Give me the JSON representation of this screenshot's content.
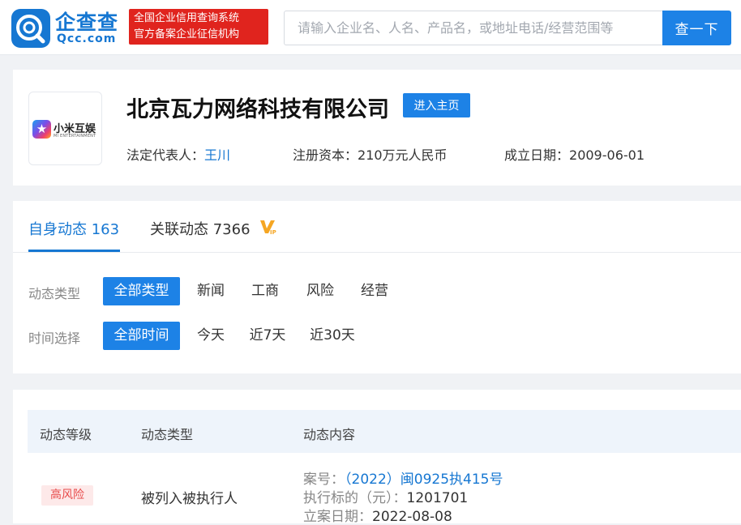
{
  "header": {
    "logo_text": "企查查",
    "logo_domain": "Qcc.com",
    "slogan_line1": "全国企业信用查询系统",
    "slogan_line2": "官方备案企业征信机构",
    "search_placeholder": "请输入企业名、人名、产品名，或地址电话/经营范围等",
    "search_button": "查一下"
  },
  "company": {
    "logo_brand": "小米互娱",
    "logo_sub": "MI ENTERTAINMENT",
    "name": "北京瓦力网络科技有限公司",
    "home_button": "进入主页",
    "legal_rep_label": "法定代表人：",
    "legal_rep_value": "王川",
    "capital_label": "注册资本：",
    "capital_value": "210万元人民币",
    "founded_label": "成立日期：",
    "founded_value": "2009-06-01"
  },
  "feed": {
    "tabs": [
      {
        "label": "自身动态",
        "count": "163",
        "active": true
      },
      {
        "label": "关联动态",
        "count": "7366",
        "active": false
      }
    ],
    "type_filter": {
      "label": "动态类型",
      "options": [
        "全部类型",
        "新闻",
        "工商",
        "风险",
        "经营"
      ],
      "selected": "全部类型"
    },
    "time_filter": {
      "label": "时间选择",
      "options": [
        "全部时间",
        "今天",
        "近7天",
        "近30天"
      ],
      "selected": "全部时间"
    }
  },
  "table": {
    "columns": [
      "动态等级",
      "动态类型",
      "动态内容"
    ],
    "rows": [
      {
        "level": "高风险",
        "type": "被列入被执行人",
        "case_no_label": "案号：",
        "case_no_value": "（2022）闽0925执415号",
        "amount_label": "执行标的（元）：",
        "amount_value": "1201701",
        "filed_label": "立案日期：",
        "filed_value": "2022-08-08"
      }
    ]
  },
  "colors": {
    "brand_blue": "#1d82e6",
    "link_blue": "#1677d2",
    "slogan_red": "#e0241e",
    "risk_red": "#e84a4a",
    "vip_orange": "#f5a623"
  },
  "icons": {
    "logo": "qcc-logo-icon",
    "vip": "vip-icon",
    "company_logo": "company-logo-star-icon"
  }
}
